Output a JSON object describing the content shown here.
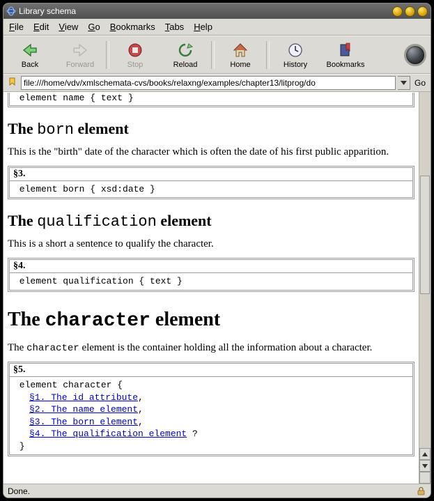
{
  "window": {
    "title": "Library schema"
  },
  "menu": {
    "file": "File",
    "edit": "Edit",
    "view": "View",
    "go": "Go",
    "bookmarks": "Bookmarks",
    "tabs": "Tabs",
    "help": "Help"
  },
  "toolbar": {
    "back": "Back",
    "forward": "Forward",
    "stop": "Stop",
    "reload": "Reload",
    "home": "Home",
    "history": "History",
    "bookmarks": "Bookmarks"
  },
  "location": {
    "url": "file:///home/vdv/xmlschemata-cvs/books/relaxng/examples/chapter13/litprog/do",
    "go": "Go"
  },
  "doc": {
    "snippet_top": " element name { text }",
    "sec_born": {
      "title_prefix": "The ",
      "title_mono": "born",
      "title_suffix": " element",
      "para": "This is the \"birth\" date of the character which is often the date of his first public apparition.",
      "num": "§3.",
      "code": " element born { xsd:date }"
    },
    "sec_qual": {
      "title_prefix": "The ",
      "title_mono": "qualification",
      "title_suffix": " element",
      "para": "This is a short a sentence to qualify the character.",
      "num": "§4.",
      "code": " element qualification { text }"
    },
    "sec_char": {
      "title_prefix": "The ",
      "title_mono": "character",
      "title_suffix": " element",
      "para_pre": "The ",
      "para_mono": "character",
      "para_post": " element is the container holding all the information about a character.",
      "num": "§5.",
      "code_open": " element character {",
      "links": [
        "§1. The id attribute",
        "§2. The name element",
        "§3. The born element",
        "§4. The qualification element"
      ],
      "link3_suffix": " ?",
      "comma": ",",
      "code_close": " }"
    }
  },
  "status": {
    "text": "Done."
  }
}
